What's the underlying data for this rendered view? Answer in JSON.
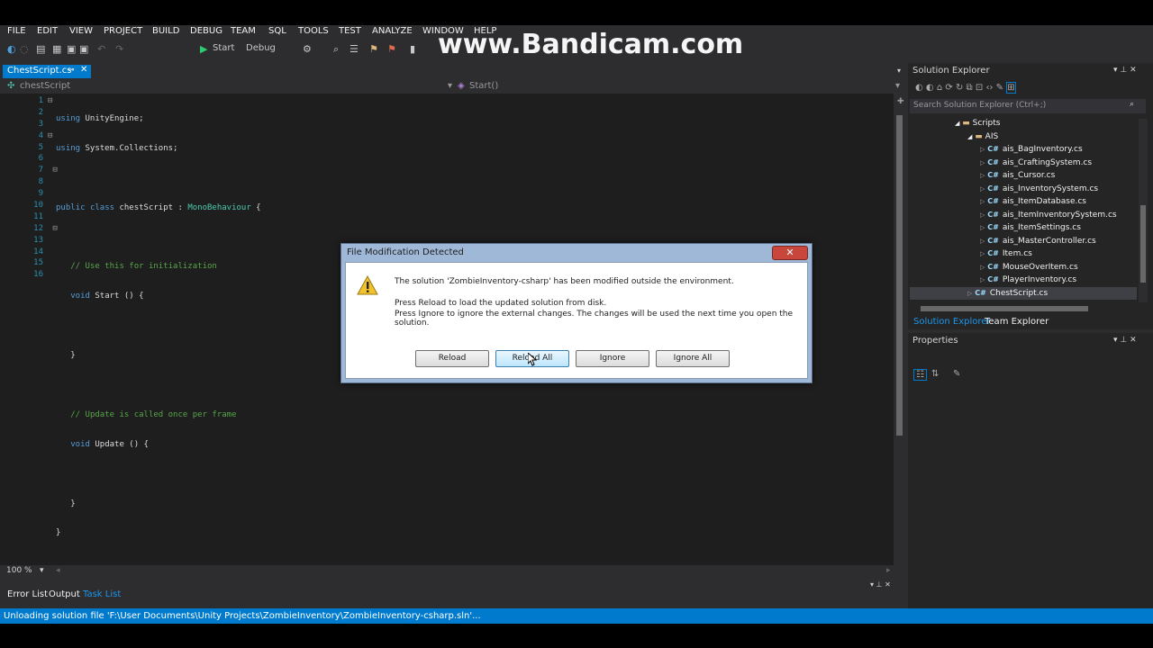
{
  "watermark": "www.Bandicam.com",
  "menu": [
    "FILE",
    "EDIT",
    "VIEW",
    "PROJECT",
    "BUILD",
    "DEBUG",
    "TEAM",
    "SQL",
    "TOOLS",
    "TEST",
    "ANALYZE",
    "WINDOW",
    "HELP"
  ],
  "toolbar": {
    "start_label": "Start",
    "config_label": "Debug"
  },
  "editor": {
    "tab_label": "ChestScript.cs",
    "nav_left": "chestScript",
    "nav_right": "Start()",
    "line_numbers": [
      "1",
      "2",
      "3",
      "4",
      "5",
      "6",
      "7",
      "8",
      "9",
      "10",
      "11",
      "12",
      "13",
      "14",
      "15",
      "16"
    ],
    "zoom": "100 %"
  },
  "code": {
    "l1_kw": "using",
    "l1_rest": " UnityEngine;",
    "l2_kw": "using",
    "l2_rest": " System.Collections;",
    "l4_kw1": "public",
    "l4_kw2": "class",
    "l4_name": " chestScript : ",
    "l4_base": "MonoBehaviour",
    "l4_brace": " {",
    "l6": "// Use this for initialization",
    "l7_kw": "void",
    "l7_rest": " Start () {",
    "l9": "}",
    "l11": "// Update is called once per frame",
    "l12_kw": "void",
    "l12_rest": " Update () {",
    "l14": "}",
    "l15": "}"
  },
  "solution_explorer": {
    "title": "Solution Explorer",
    "search_placeholder": "Search Solution Explorer (Ctrl+;)",
    "folder_scripts": "Scripts",
    "folder_ais": "AIS",
    "files": [
      "ais_BagInventory.cs",
      "ais_CraftingSystem.cs",
      "ais_Cursor.cs",
      "ais_InventorySystem.cs",
      "ais_ItemDatabase.cs",
      "ais_ItemInventorySystem.cs",
      "ais_ItemSettings.cs",
      "ais_MasterController.cs",
      "Item.cs",
      "MouseOverItem.cs",
      "PlayerInventory.cs"
    ],
    "selected_file": "ChestScript.cs",
    "cs_badge": "C#",
    "tab_solution": "Solution Explorer",
    "tab_team": "Team Explorer"
  },
  "properties": {
    "title": "Properties"
  },
  "bottom_tabs": [
    "Error List",
    "Output",
    "Task List"
  ],
  "dialog": {
    "title": "File Modification Detected",
    "close": "✕",
    "message": "The solution 'ZombieInventory-csharp' has been modified outside the environment.",
    "detail1": "Press Reload to load the updated solution from disk.",
    "detail2": "Press Ignore to ignore the external changes. The changes will be used the next time you open the solution.",
    "buttons": {
      "reload": "Reload",
      "reload_all": "Reload All",
      "ignore": "Ignore",
      "ignore_all": "Ignore All"
    }
  },
  "status_bar": "Unloading solution file 'F:\\User Documents\\Unity Projects\\ZombieInventory\\ZombieInventory-csharp.sln'...",
  "colors": {
    "accent": "#007acc",
    "background": "#2d2d30",
    "editor": "#1e1e1e",
    "keyword": "#569cd6",
    "type": "#4ec9b0",
    "comment": "#57a64a"
  }
}
